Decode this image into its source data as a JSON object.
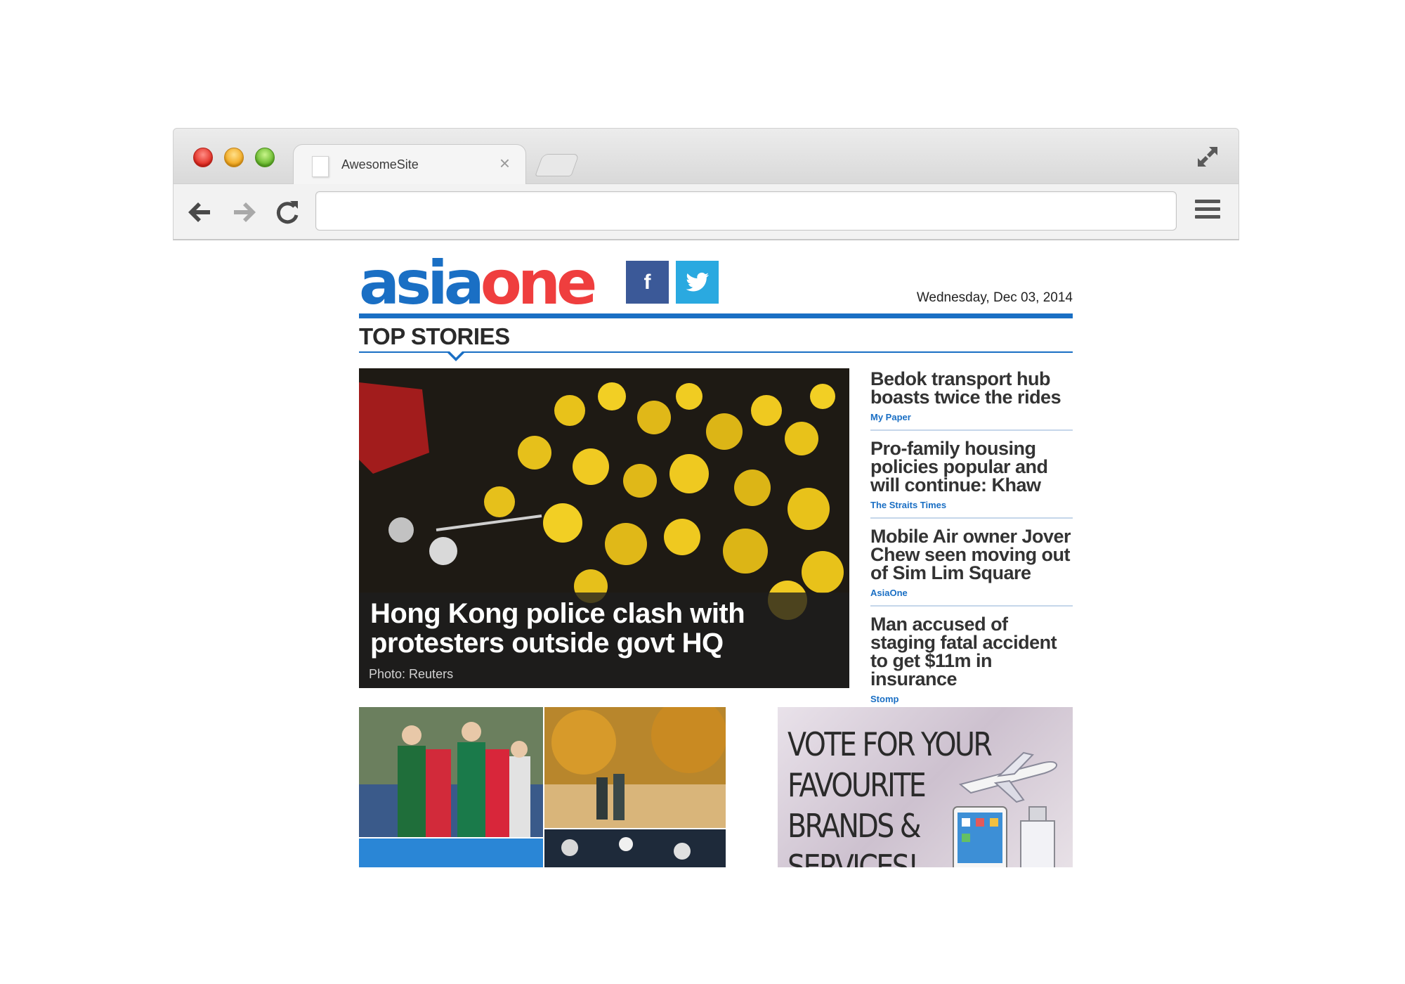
{
  "browser": {
    "tab_title": "AwesomeSite",
    "tab_close": "×",
    "url": ""
  },
  "site": {
    "logo_asia": "asia",
    "logo_one": "one",
    "facebook_glyph": "f",
    "date": "Wednesday, Dec 03, 2014",
    "section_title": "TOP STORIES"
  },
  "hero": {
    "headline": "Hong Kong police clash with protesters outside govt HQ",
    "credit": "Photo: Reuters"
  },
  "stories": [
    {
      "title": "Bedok transport hub boasts twice the rides",
      "source": "My Paper"
    },
    {
      "title": "Pro-family housing policies popular and will continue: Khaw",
      "source": "The Straits Times"
    },
    {
      "title": "Mobile Air owner Jover Chew seen moving out of Sim Lim Square",
      "source": "AsiaOne"
    },
    {
      "title": "Man accused of staging fatal accident to get $11m in insurance",
      "source": "Stomp"
    }
  ],
  "ad": {
    "text_line1": "VOTE FOR YOUR",
    "text_line2": "FAVOURITE",
    "text_line3": "BRANDS &",
    "text_line4": "SERVICES!"
  },
  "colors": {
    "brand_blue": "#1a6fc4",
    "brand_red": "#ef3e3e",
    "facebook": "#3b5998",
    "twitter": "#2aa9e0"
  }
}
